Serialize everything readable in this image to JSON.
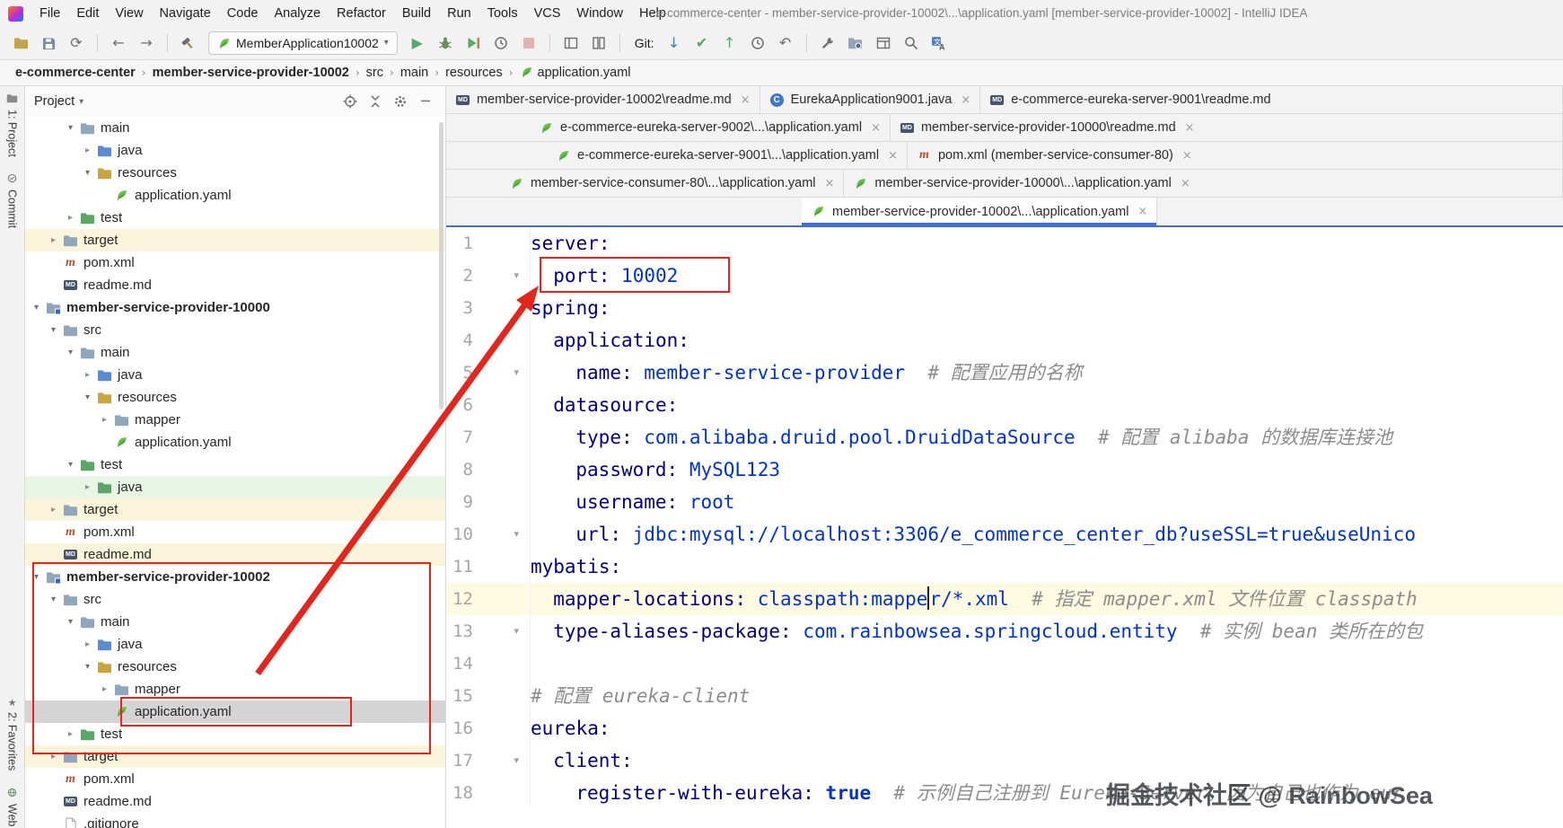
{
  "window": {
    "title": "e-commerce-center - member-service-provider-10002\\...\\application.yaml [member-service-provider-10002] - IntelliJ IDEA"
  },
  "menu_bar": {
    "items": [
      "File",
      "Edit",
      "View",
      "Navigate",
      "Code",
      "Analyze",
      "Refactor",
      "Build",
      "Run",
      "Tools",
      "VCS",
      "Window",
      "Help"
    ]
  },
  "toolbar": {
    "left_icons": [
      "open-project-icon",
      "save-all-icon",
      "sync-icon",
      "back-icon",
      "forward-icon",
      "build-hammer-icon"
    ],
    "run_configuration": "MemberApplication10002",
    "run_icons": [
      "run-icon",
      "debug-icon",
      "coverage-icon",
      "profiler-icon",
      "stop-icon"
    ],
    "mid_icons": [
      "layout-editor-icon",
      "compare-icon"
    ],
    "git_label": "Git:",
    "git_icons": [
      "git-update-icon",
      "git-commit-icon",
      "git-push-icon",
      "git-history-icon",
      "git-rollback-icon"
    ],
    "right_icons": [
      "wrench-icon",
      "project-structure-icon",
      "restore-layout-icon",
      "search-everywhere-icon",
      "translate-icon"
    ]
  },
  "breadcrumbs": [
    "e-commerce-center",
    "member-service-provider-10002",
    "src",
    "main",
    "resources",
    "application.yaml"
  ],
  "tool_strips": {
    "left_top": [
      {
        "label": "1: Project",
        "icon": "project-tool-icon"
      },
      {
        "label": "Commit",
        "icon": "commit-tool-icon"
      }
    ],
    "left_bottom": [
      {
        "label": "2: Favorites",
        "icon": "favorites-star-icon"
      },
      {
        "label": "Web",
        "icon": "web-tool-icon"
      }
    ]
  },
  "project_panel": {
    "title": "Project",
    "header_icons": [
      "locate-icon",
      "collapse-all-icon",
      "settings-gear-icon",
      "hide-panel-icon"
    ],
    "tree": [
      {
        "label": "main",
        "level": 3,
        "icon": "folder",
        "expand": "open"
      },
      {
        "label": "java",
        "level": 4,
        "icon": "folder-src",
        "expand": "closed"
      },
      {
        "label": "resources",
        "level": 4,
        "icon": "folder-res",
        "expand": "open"
      },
      {
        "label": "application.yaml",
        "level": 5,
        "icon": "yaml",
        "expand": "none"
      },
      {
        "label": "test",
        "level": 3,
        "icon": "folder-test",
        "expand": "closed"
      },
      {
        "label": "target",
        "level": 2,
        "icon": "folder",
        "expand": "closed",
        "bg": "yellow"
      },
      {
        "label": "pom.xml",
        "level": 2,
        "icon": "pom",
        "expand": "none"
      },
      {
        "label": "readme.md",
        "level": 2,
        "icon": "md",
        "expand": "none"
      },
      {
        "label": "member-service-provider-10000",
        "level": 1,
        "icon": "module",
        "expand": "open",
        "bold": true
      },
      {
        "label": "src",
        "level": 2,
        "icon": "folder",
        "expand": "open"
      },
      {
        "label": "main",
        "level": 3,
        "icon": "folder",
        "expand": "open"
      },
      {
        "label": "java",
        "level": 4,
        "icon": "folder-src",
        "expand": "closed"
      },
      {
        "label": "resources",
        "level": 4,
        "icon": "folder-res",
        "expand": "open"
      },
      {
        "label": "mapper",
        "level": 5,
        "icon": "folder",
        "expand": "closed"
      },
      {
        "label": "application.yaml",
        "level": 5,
        "icon": "yaml",
        "expand": "none"
      },
      {
        "label": "test",
        "level": 3,
        "icon": "folder-test",
        "expand": "open"
      },
      {
        "label": "java",
        "level": 4,
        "icon": "folder-test",
        "expand": "closed",
        "bg": "green"
      },
      {
        "label": "target",
        "level": 2,
        "icon": "folder",
        "expand": "closed",
        "bg": "yellow"
      },
      {
        "label": "pom.xml",
        "level": 2,
        "icon": "pom",
        "expand": "none"
      },
      {
        "label": "readme.md",
        "level": 2,
        "icon": "md",
        "expand": "none",
        "bg": "yellow"
      },
      {
        "label": "member-service-provider-10002",
        "level": 1,
        "icon": "module",
        "expand": "open",
        "bold": true
      },
      {
        "label": "src",
        "level": 2,
        "icon": "folder",
        "expand": "open"
      },
      {
        "label": "main",
        "level": 3,
        "icon": "folder",
        "expand": "open"
      },
      {
        "label": "java",
        "level": 4,
        "icon": "folder-src",
        "expand": "closed"
      },
      {
        "label": "resources",
        "level": 4,
        "icon": "folder-res",
        "expand": "open"
      },
      {
        "label": "mapper",
        "level": 5,
        "icon": "folder",
        "expand": "closed"
      },
      {
        "label": "application.yaml",
        "level": 5,
        "icon": "yaml",
        "expand": "none",
        "bg": "selected"
      },
      {
        "label": "test",
        "level": 3,
        "icon": "folder-test",
        "expand": "closed"
      },
      {
        "label": "target",
        "level": 2,
        "icon": "folder",
        "expand": "closed",
        "bg": "yellow"
      },
      {
        "label": "pom.xml",
        "level": 2,
        "icon": "pom",
        "expand": "none"
      },
      {
        "label": "readme.md",
        "level": 2,
        "icon": "md",
        "expand": "none"
      },
      {
        "label": ".gitignore",
        "level": 2,
        "icon": "file",
        "expand": "none"
      }
    ]
  },
  "editor_tabs": {
    "rows": [
      {
        "offset": 0,
        "tabs": [
          {
            "icon": "md",
            "label": "member-service-provider-10002\\readme.md",
            "close": true
          },
          {
            "icon": "class",
            "label": "EurekaApplication9001.java",
            "close": true
          },
          {
            "icon": "md",
            "label": "e-commerce-eureka-server-9001\\readme.md",
            "close": false,
            "grow": true
          }
        ]
      },
      {
        "offset": 93,
        "tabs": [
          {
            "icon": "yaml",
            "label": "e-commerce-eureka-server-9002\\...\\application.yaml",
            "close": true
          },
          {
            "icon": "md",
            "label": "member-service-provider-10000\\readme.md",
            "close": true,
            "grow": true
          }
        ]
      },
      {
        "offset": 112,
        "tabs": [
          {
            "icon": "yaml",
            "label": "e-commerce-eureka-server-9001\\...\\application.yaml",
            "close": true
          },
          {
            "icon": "pom",
            "label": "pom.xml (member-service-consumer-80)",
            "close": true,
            "grow": true
          }
        ]
      },
      {
        "offset": 60,
        "tabs": [
          {
            "icon": "yaml",
            "label": "member-service-consumer-80\\...\\application.yaml",
            "close": true
          },
          {
            "icon": "yaml",
            "label": "member-service-provider-10000\\...\\application.yaml",
            "close": true,
            "grow": true
          }
        ]
      },
      {
        "offset": 396,
        "tabs": [
          {
            "icon": "yaml",
            "label": "member-service-provider-10002\\...\\application.yaml",
            "close": true,
            "active": true
          }
        ]
      }
    ]
  },
  "editor": {
    "lines": [
      {
        "num": "1",
        "indent": 0,
        "segments": [
          {
            "t": "key",
            "x": "server:"
          }
        ]
      },
      {
        "num": "2",
        "indent": 2,
        "fold": true,
        "segments": [
          {
            "t": "key",
            "x": "port:"
          },
          {
            "t": "value",
            "x": " 10002"
          }
        ]
      },
      {
        "num": "3",
        "indent": 0,
        "segments": [
          {
            "t": "key",
            "x": "spring:"
          }
        ]
      },
      {
        "num": "4",
        "indent": 2,
        "segments": [
          {
            "t": "key",
            "x": "application:"
          }
        ]
      },
      {
        "num": "5",
        "indent": 4,
        "fold": true,
        "segments": [
          {
            "t": "key",
            "x": "name:"
          },
          {
            "t": "value",
            "x": " member-service-provider"
          },
          {
            "t": "comment",
            "x": "  # 配置应用的名称"
          }
        ]
      },
      {
        "num": "6",
        "indent": 2,
        "segments": [
          {
            "t": "key",
            "x": "datasource:"
          }
        ]
      },
      {
        "num": "7",
        "indent": 4,
        "segments": [
          {
            "t": "key",
            "x": "type:"
          },
          {
            "t": "value",
            "x": " com.alibaba.druid.pool.DruidDataSource"
          },
          {
            "t": "comment",
            "x": "  # 配置 alibaba 的数据库连接池"
          }
        ]
      },
      {
        "num": "8",
        "indent": 4,
        "segments": [
          {
            "t": "key",
            "x": "password:"
          },
          {
            "t": "value",
            "x": " MySQL123"
          }
        ]
      },
      {
        "num": "9",
        "indent": 4,
        "segments": [
          {
            "t": "key",
            "x": "username:"
          },
          {
            "t": "value",
            "x": " root"
          }
        ]
      },
      {
        "num": "10",
        "indent": 4,
        "fold": true,
        "segments": [
          {
            "t": "key",
            "x": "url:"
          },
          {
            "t": "value",
            "x": " jdbc:mysql://localhost:3306/e_commerce_center_db?useSSL=true&useUnico"
          }
        ]
      },
      {
        "num": "11",
        "indent": 0,
        "segments": [
          {
            "t": "key",
            "x": "mybatis:"
          }
        ]
      },
      {
        "num": "12",
        "indent": 2,
        "caretLine": true,
        "segments": [
          {
            "t": "key",
            "x": "mapper-locations:"
          },
          {
            "t": "value",
            "x": " classpath:mappe"
          },
          {
            "t": "caret"
          },
          {
            "t": "value",
            "x": "r/*.xml"
          },
          {
            "t": "comment",
            "x": "  # 指定 mapper.xml 文件位置 classpath"
          }
        ]
      },
      {
        "num": "13",
        "indent": 2,
        "fold": true,
        "segments": [
          {
            "t": "key",
            "x": "type-aliases-package:"
          },
          {
            "t": "value",
            "x": " com.rainbowsea.springcloud.entity"
          },
          {
            "t": "comment",
            "x": "  # 实例 bean 类所在的包"
          }
        ]
      },
      {
        "num": "14",
        "indent": 0,
        "segments": []
      },
      {
        "num": "15",
        "indent": 0,
        "segments": [
          {
            "t": "comment",
            "x": "# 配置 eureka-client"
          }
        ]
      },
      {
        "num": "16",
        "indent": 0,
        "segments": [
          {
            "t": "key",
            "x": "eureka:"
          }
        ]
      },
      {
        "num": "17",
        "indent": 2,
        "fold": true,
        "segments": [
          {
            "t": "key",
            "x": "client:"
          }
        ]
      },
      {
        "num": "18",
        "indent": 4,
        "segments": [
          {
            "t": "key",
            "x": "register-with-eureka:"
          },
          {
            "t": "bool",
            "x": " true"
          },
          {
            "t": "comment",
            "x": "  # 示例自己注册到 Eureka-Server，因为自己也作为 eur"
          }
        ]
      }
    ]
  },
  "annotations": {
    "watermark": "掘金技术社区 @ RainbowSea"
  },
  "colors": {
    "accent_blue": "#3D6FD4",
    "annotation_red": "#E3261D",
    "yaml_key": "#000080",
    "yaml_value": "#0033CC",
    "comment_gray": "#8C8C8C",
    "selected_row": "#D4D4D4",
    "excluded_row_yellow": "#FAF5DA",
    "test_row_green": "#E9F5E4"
  }
}
